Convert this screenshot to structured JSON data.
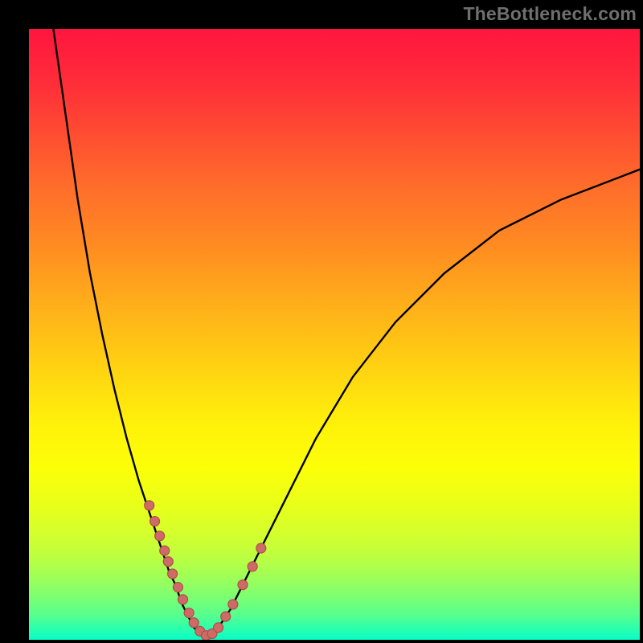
{
  "watermark": "TheBottleneck.com",
  "chart_data": {
    "type": "line",
    "title": "",
    "xlabel": "",
    "ylabel": "",
    "xlim": [
      0,
      100
    ],
    "ylim": [
      0,
      100
    ],
    "legend": false,
    "grid": false,
    "background_gradient": {
      "top": "#ff163e",
      "bottom": "#08ffc6",
      "description": "vertical red-to-green"
    },
    "series": [
      {
        "name": "left-branch",
        "x": [
          4,
          6,
          8,
          10,
          12,
          14,
          16,
          18,
          19,
          20,
          21,
          22,
          23,
          24,
          25,
          26,
          27
        ],
        "values": [
          100,
          86,
          72,
          60,
          50,
          41,
          33,
          26,
          23,
          20,
          17,
          14,
          11,
          9,
          6,
          4,
          2
        ]
      },
      {
        "name": "valley",
        "x": [
          27,
          28,
          29,
          30,
          31
        ],
        "values": [
          2,
          1,
          0.6,
          1,
          2
        ]
      },
      {
        "name": "right-branch",
        "x": [
          31,
          33,
          35,
          38,
          42,
          47,
          53,
          60,
          68,
          77,
          87,
          100
        ],
        "values": [
          2,
          5,
          9,
          15,
          23,
          33,
          43,
          52,
          60,
          67,
          72,
          77
        ]
      }
    ],
    "markers": {
      "type": "scatter",
      "name": "beads",
      "color": "#cf6b66",
      "size": 12,
      "x": [
        19.7,
        20.6,
        21.4,
        22.2,
        22.8,
        23.5,
        24.4,
        25.2,
        26.2,
        27.0,
        28.0,
        29.0,
        30.0,
        31.0,
        32.2,
        33.4,
        35.0,
        36.6,
        38.0
      ],
      "values": [
        22.0,
        19.4,
        17.0,
        14.6,
        12.8,
        10.8,
        8.6,
        6.6,
        4.4,
        2.8,
        1.4,
        0.7,
        1.0,
        2.0,
        3.8,
        5.8,
        9.0,
        12.0,
        15.0
      ]
    }
  }
}
